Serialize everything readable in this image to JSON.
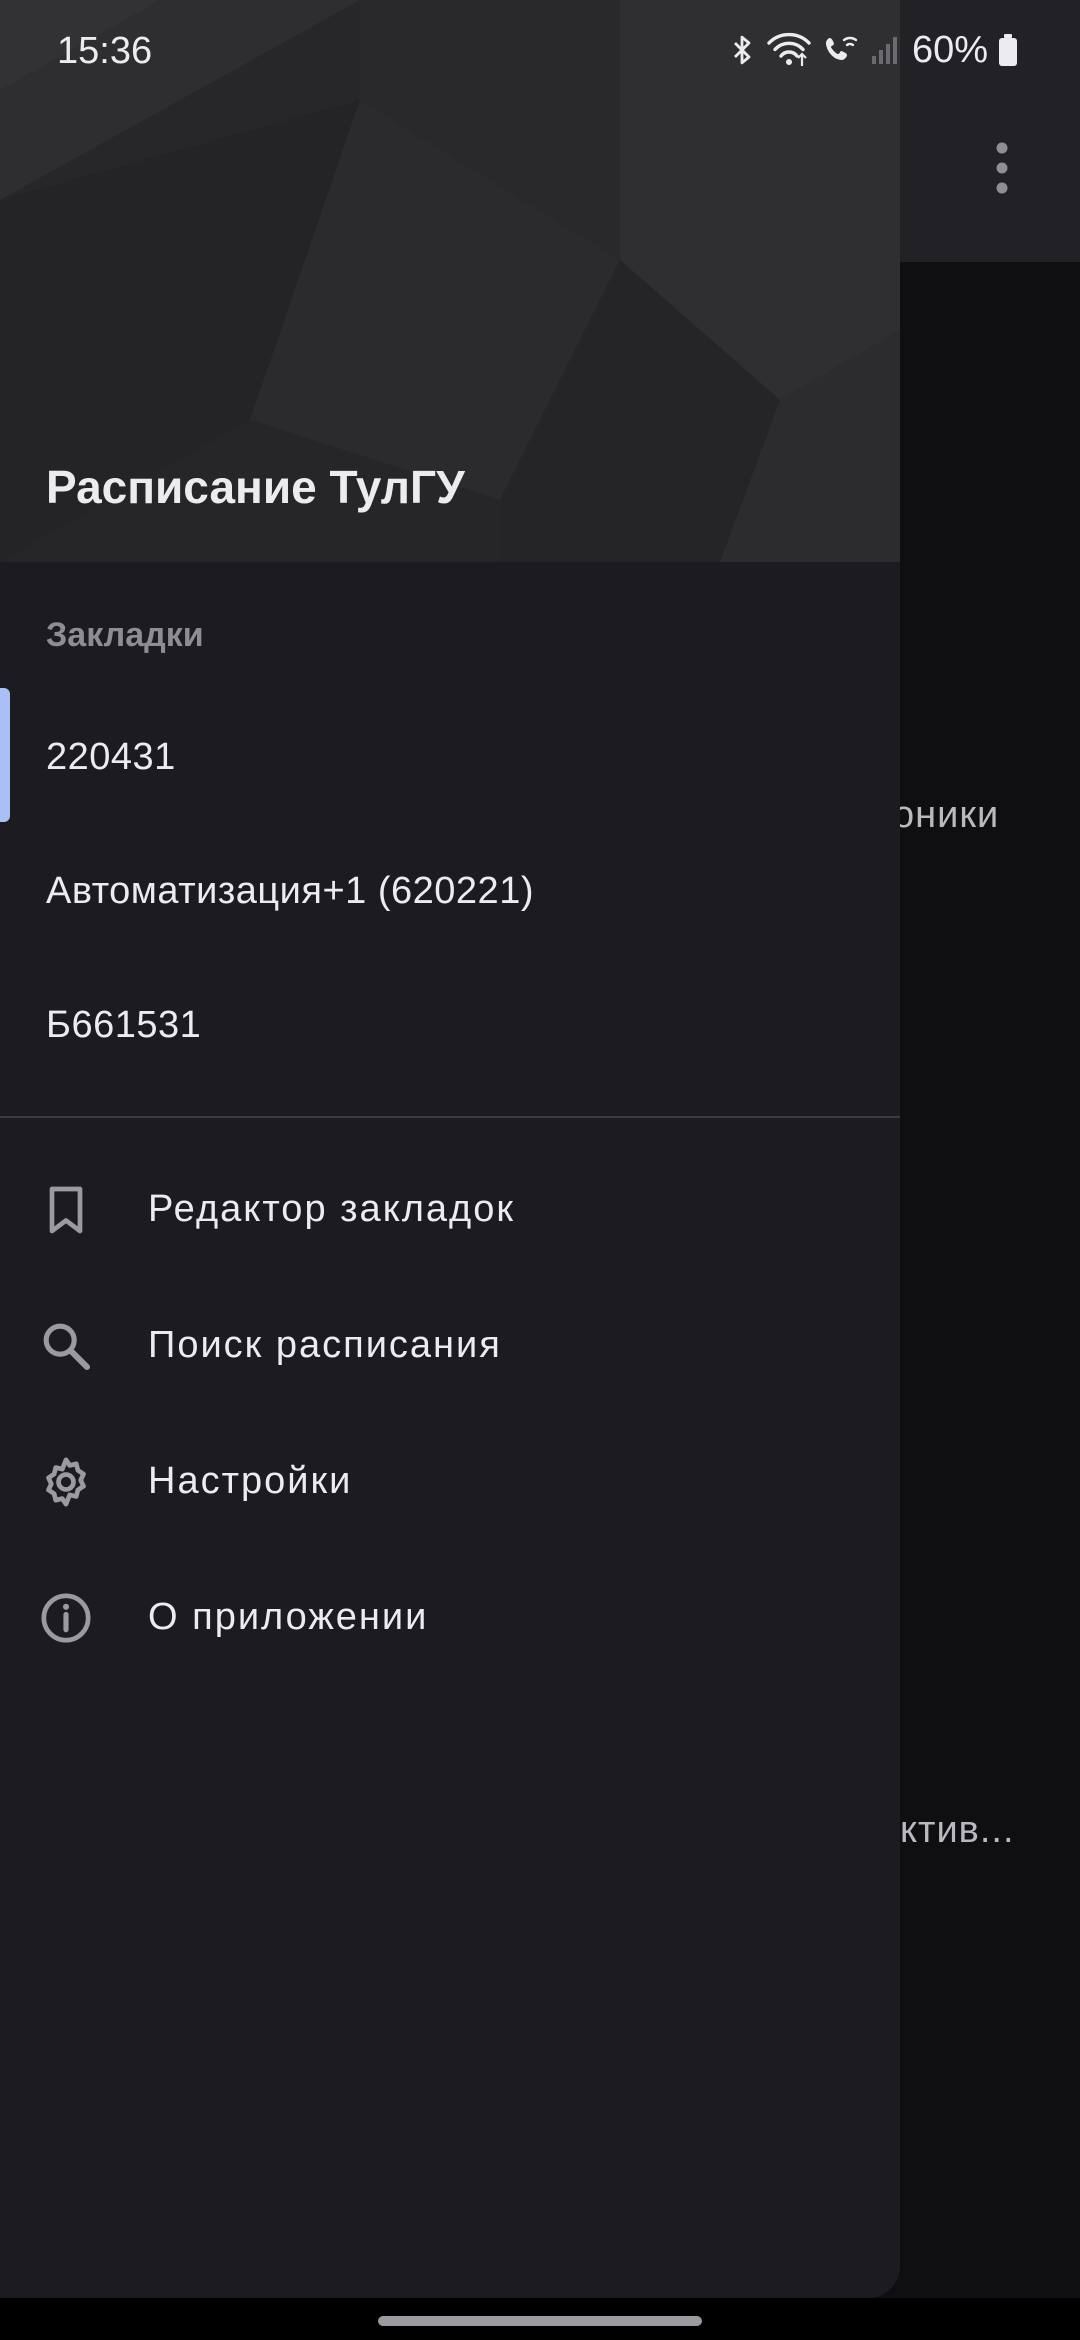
{
  "status_bar": {
    "time": "15:36",
    "battery": "60%",
    "icons": [
      "bluetooth-icon",
      "wifi-icon",
      "wifi-calling-icon",
      "cellular-signal-icon",
      "battery-icon"
    ]
  },
  "background_app": {
    "overflow_icon": "more-vert-icon",
    "partial_text_1": "оники",
    "partial_text_2": "ктив..."
  },
  "drawer": {
    "header_title": "Расписание ТулГУ",
    "bookmarks_heading": "Закладки",
    "bookmarks": [
      {
        "label": "220431",
        "active": true
      },
      {
        "label": "Автоматизация+1 (620221)",
        "active": false
      },
      {
        "label": "Б661531",
        "active": false
      }
    ],
    "menu": [
      {
        "label": "Редактор закладок",
        "icon": "bookmark-icon"
      },
      {
        "label": "Поиск расписания",
        "icon": "search-icon"
      },
      {
        "label": "Настройки",
        "icon": "gear-icon"
      },
      {
        "label": "О приложении",
        "icon": "info-icon"
      }
    ]
  },
  "colors": {
    "drawer_bg": "#1c1c20",
    "header_bg": "#27272a",
    "active_indicator": "#a9bff5",
    "text_primary": "#ececf0",
    "text_secondary": "#8d8d94"
  }
}
